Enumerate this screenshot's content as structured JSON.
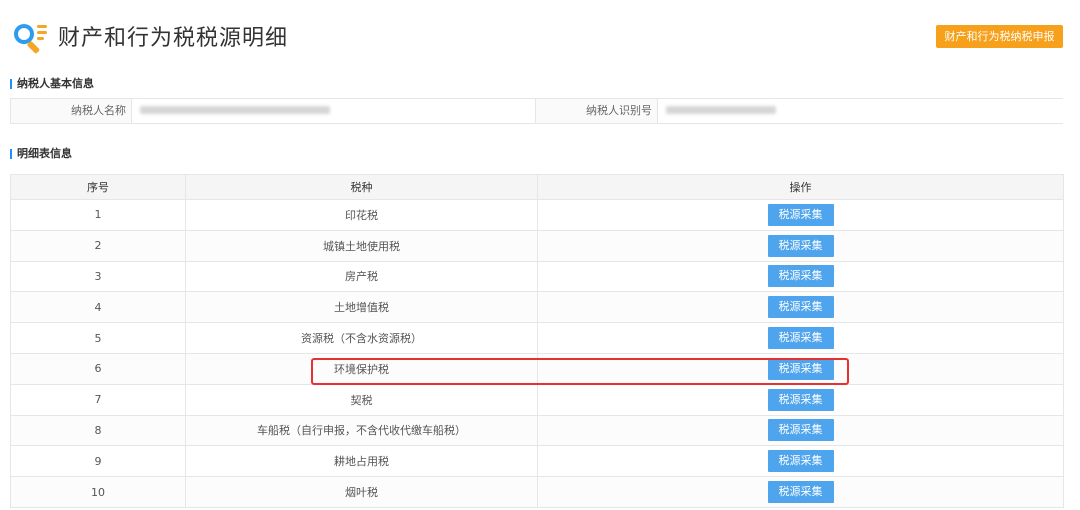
{
  "header": {
    "title": "财产和行为税税源明细",
    "declare_button": "财产和行为税纳税申报"
  },
  "taxpayer_section": {
    "title": "纳税人基本信息",
    "name_label": "纳税人名称",
    "id_label": "纳税人识别号"
  },
  "detail_section": {
    "title": "明细表信息"
  },
  "table": {
    "columns": [
      "序号",
      "税种",
      "操作"
    ],
    "action_label": "税源采集",
    "rows": [
      {
        "no": "1",
        "tax": "印花税"
      },
      {
        "no": "2",
        "tax": "城镇土地使用税"
      },
      {
        "no": "3",
        "tax": "房产税"
      },
      {
        "no": "4",
        "tax": "土地增值税"
      },
      {
        "no": "5",
        "tax": "资源税（不含水资源税）"
      },
      {
        "no": "6",
        "tax": "环境保护税"
      },
      {
        "no": "7",
        "tax": "契税"
      },
      {
        "no": "8",
        "tax": "车船税（自行申报，不含代收代缴车船税）"
      },
      {
        "no": "9",
        "tax": "耕地占用税"
      },
      {
        "no": "10",
        "tax": "烟叶税"
      }
    ]
  },
  "colors": {
    "accent": "#f7a01b",
    "button": "#4fa4ee",
    "highlight": "#e8312f",
    "section_marker": "#1e90ff"
  },
  "icons": {
    "logo": "search-list-icon"
  }
}
